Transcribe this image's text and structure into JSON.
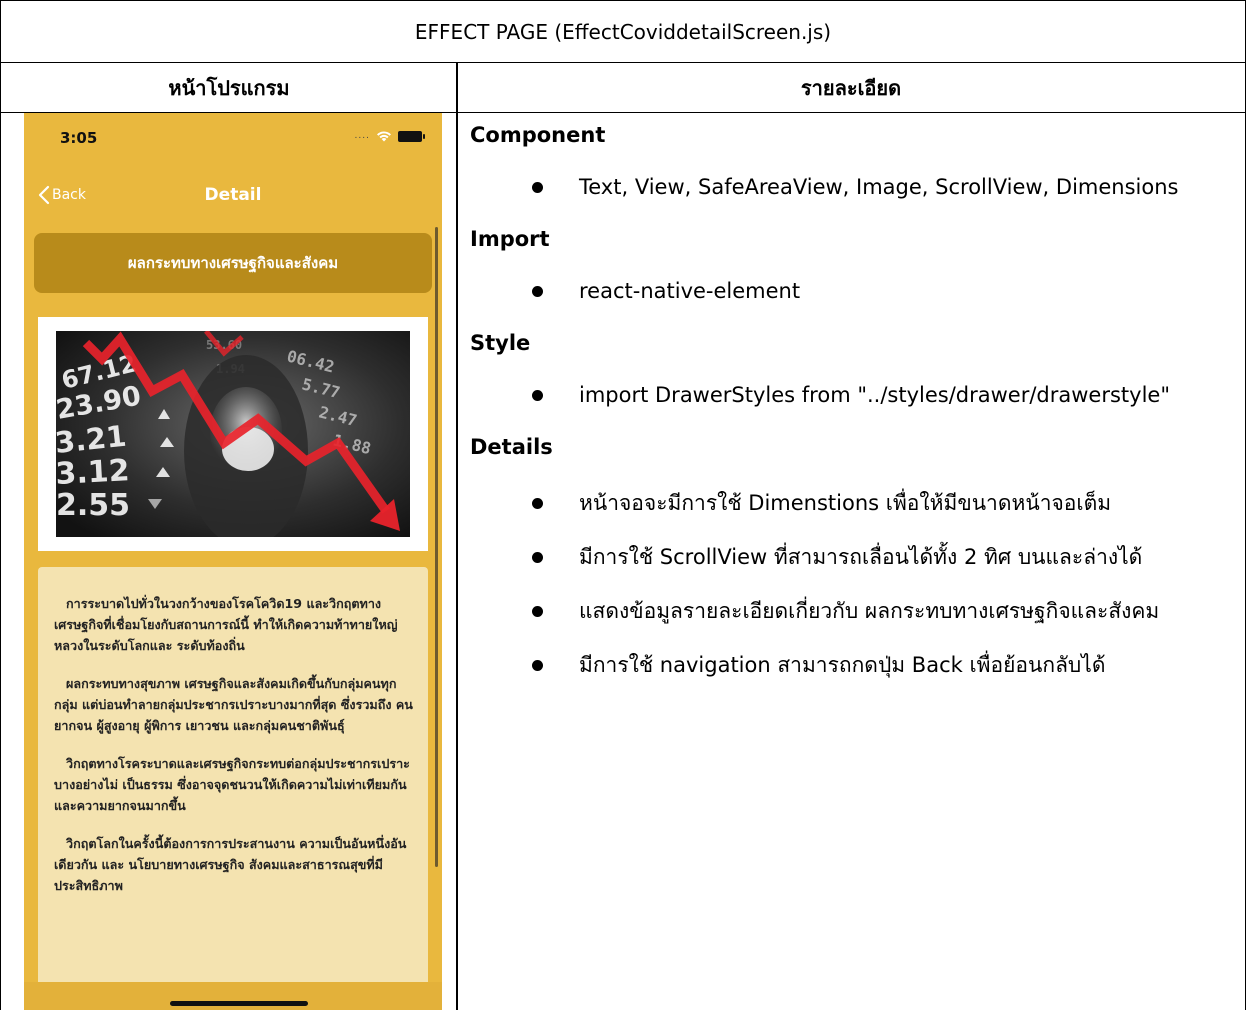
{
  "document": {
    "title": "EFFECT PAGE (EffectCoviddetailScreen.js)",
    "col_left_header": "หน้าโปรแกรม",
    "col_right_header": "รายละเอียด"
  },
  "phone": {
    "status_time": "3:05",
    "signal": "....",
    "nav_back_label": "Back",
    "nav_title": "Detail",
    "heading": "ผลกระทบทางเศรษฐกิจและสังคม",
    "image_numbers": [
      "67.12",
      "23.90",
      "3.21",
      "3.12",
      "2.55"
    ],
    "paragraphs": [
      "การระบาดไปทั่วในวงกว้างของโรคโควิด19 และวิกฤตทางเศรษฐกิจที่เชื่อมโยงกับสถานการณ์นี้ ทำให้เกิดความท้าทายใหญ่หลวงในระดับโลกและ ระดับท้องถิ่น",
      "ผลกระทบทางสุขภาพ เศรษฐกิจและสังคมเกิดขึ้นกับกลุ่มคนทุกกลุ่ม แต่บ่อนทำลายกลุ่มประชากรเปราะบางมากที่สุด ซึ่งรวมถึง คนยากจน ผู้สูงอายุ ผู้พิการ เยาวชน และกลุ่มคนชาติพันธุ์",
      "วิกฤตทางโรคระบาดและเศรษฐกิจกระทบต่อกลุ่มประชากรเปราะบางอย่างไม่ เป็นธรรม ซึ่งอาจจุดชนวนให้เกิดความไม่เท่าเทียมกันและความยากจนมากขึ้น",
      "วิกฤตโลกในครั้งนี้ต้องการการประสานงาน ความเป็นอันหนึ่งอันเดียวกัน และ นโยบายทางเศรษฐกิจ สังคมและสาธารณสุขที่มีประสิทธิภาพ"
    ]
  },
  "details": {
    "component_title": "Component",
    "component_items": [
      "Text, View, SafeAreaView, Image, ScrollView, Dimensions"
    ],
    "import_title": "Import",
    "import_items": [
      "react-native-element"
    ],
    "style_title": "Style",
    "style_items": [
      "import DrawerStyles from \"../styles/drawer/drawerstyle\""
    ],
    "details_title": "Details",
    "details_items": [
      " หน้าจอจะมีการใช้ Dimenstions เพื่อให้มีขนาดหน้าจอเต็ม",
      "มีการใช้ ScrollView ที่สามารถเลื่อนได้ทั้ง 2 ทิศ บนและล่างได้",
      "แสดงข้อมูลรายละเอียดเกี่ยวกับ ผลกระทบทางเศรษฐกิจและสังคม",
      "มีการใช้ navigation สามารถกดปุ่ม Back เพื่อย้อนกลับได้"
    ]
  },
  "colors": {
    "phone_bg": "#e9b83e",
    "heading_card": "#b88b1b",
    "text_card": "#f4e3b0",
    "chart_red": "#e8232b"
  }
}
